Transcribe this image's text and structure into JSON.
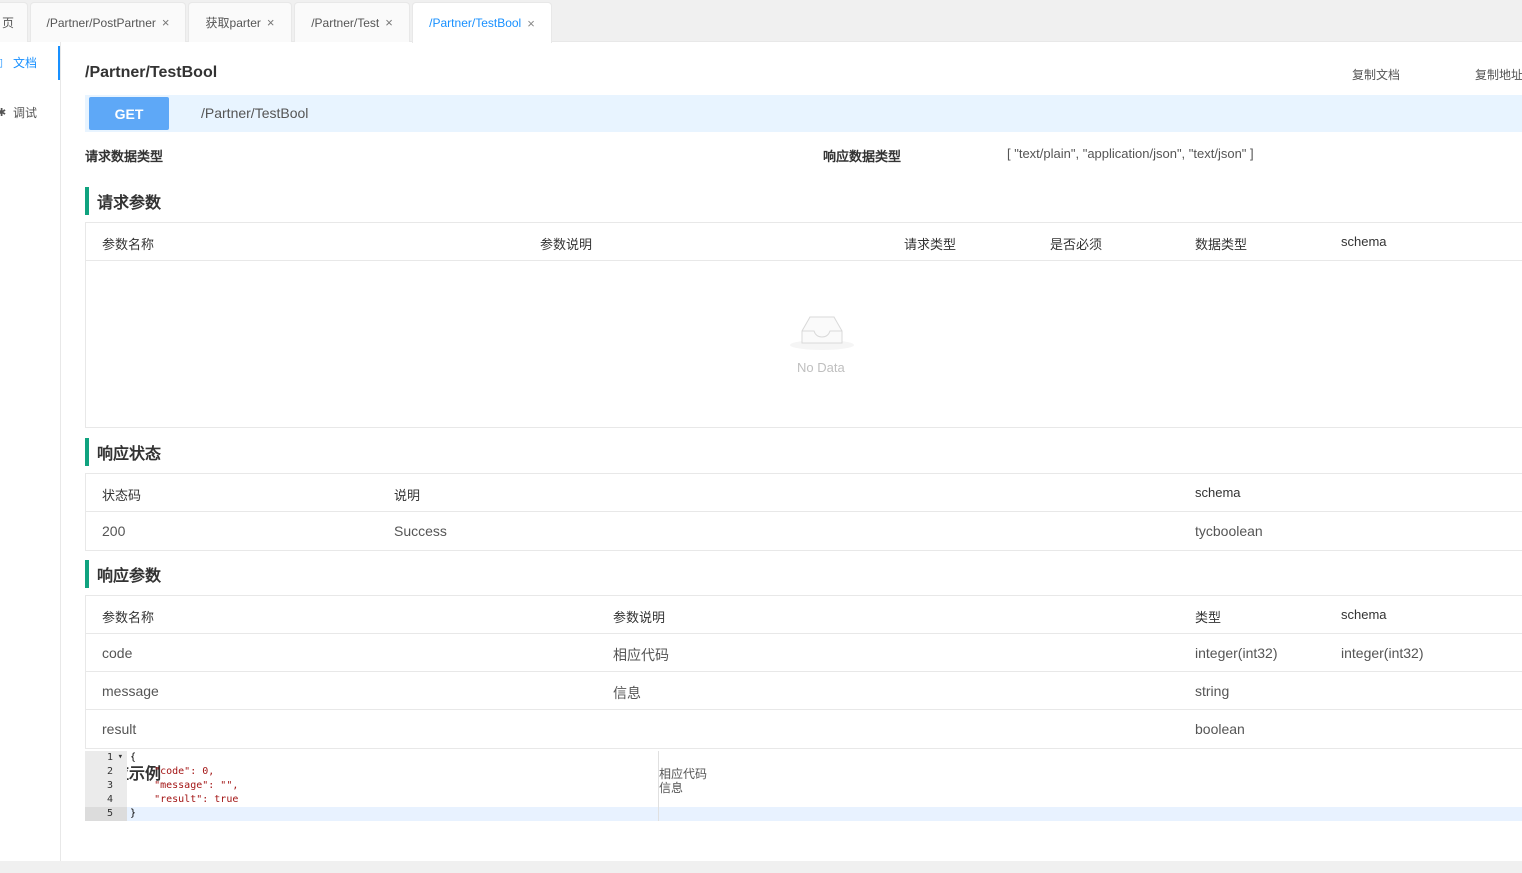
{
  "tabs": [
    {
      "label": "页",
      "closable": false,
      "active": false
    },
    {
      "label": "/Partner/PostPartner",
      "closable": true,
      "active": false
    },
    {
      "label": "获取parter",
      "closable": true,
      "active": false
    },
    {
      "label": "/Partner/Test",
      "closable": true,
      "active": false
    },
    {
      "label": "/Partner/TestBool",
      "closable": true,
      "active": true
    }
  ],
  "close_glyph": "×",
  "sidebar": {
    "items": [
      {
        "label": "文档",
        "icon": "doc-icon",
        "glyph": "▯",
        "active": true
      },
      {
        "label": "调试",
        "icon": "debug-icon",
        "glyph": "✱",
        "active": false
      }
    ]
  },
  "doc": {
    "title": "/Partner/TestBool",
    "copy_doc": "复制文档",
    "copy_url": "复制地址",
    "method": "GET",
    "path": "/Partner/TestBool",
    "request_type_label": "请求数据类型",
    "response_type_label": "响应数据类型",
    "response_type_value": "[ \"text/plain\", \"application/json\", \"text/json\" ]"
  },
  "request_params": {
    "title": "请求参数",
    "headers": [
      "参数名称",
      "参数说明",
      "请求类型",
      "是否必须",
      "数据类型",
      "schema"
    ],
    "empty_text": "No Data"
  },
  "response_status": {
    "title": "响应状态",
    "headers": [
      "状态码",
      "说明",
      "schema"
    ],
    "rows": [
      [
        "200",
        "Success",
        "tycboolean"
      ]
    ]
  },
  "response_params": {
    "title": "响应参数",
    "headers": [
      "参数名称",
      "参数说明",
      "类型",
      "schema"
    ],
    "rows": [
      [
        "code",
        "相应代码",
        "integer(int32)",
        "integer(int32)"
      ],
      [
        "message",
        "信息",
        "string",
        ""
      ],
      [
        "result",
        "",
        "boolean",
        ""
      ]
    ]
  },
  "response_example": {
    "title": "响应示例",
    "line_numbers": [
      "1",
      "2",
      "3",
      "4",
      "5"
    ],
    "fold_marker": "▾",
    "lines": [
      "{",
      "    \"code\": 0,",
      "    \"message\": \"\",",
      "    \"result\": true",
      "}"
    ],
    "comments": [
      "相应代码",
      "信息"
    ]
  },
  "colors": {
    "accent": "#1890ff",
    "method_get": "#5ea8f7",
    "section_bar": "#10a37f"
  }
}
